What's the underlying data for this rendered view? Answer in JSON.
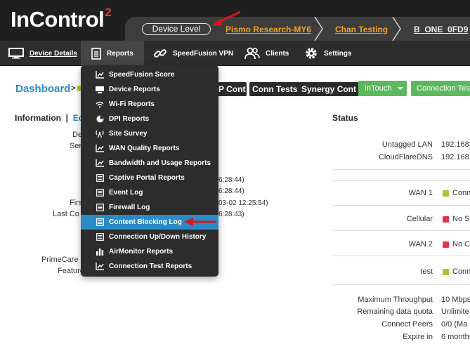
{
  "header": {
    "logo_text": "InControl",
    "logo_sup": "2",
    "device_level": "Device Level",
    "breadcrumbs": [
      "Pismo Research-MY6",
      "Chan Testing",
      "B_ONE_0FD9"
    ]
  },
  "nav": {
    "device_details": "Device Details",
    "reports": "Reports",
    "speedfusion_vpn": "SpeedFusion VPN",
    "clients": "Clients",
    "settings": "Settings"
  },
  "dashboard": {
    "title": "Dashboard",
    "separator": ">",
    "buttons": [
      "P Cont",
      "Conn Tests",
      "Synergy Cont"
    ],
    "intouch": "InTouch",
    "connection_test": "Connection Test"
  },
  "info": {
    "title": "Information",
    "separator": "|",
    "edit": "Ed",
    "labels": [
      "De",
      "Ser",
      "Firs",
      "Last Co",
      "PrimeCare E",
      "Feature"
    ],
    "values": [
      "6:28:44)",
      "6:28:44)",
      "03-02 12:25:54)",
      "6:28:43)"
    ]
  },
  "status": {
    "title": "Status",
    "rows": [
      {
        "label": "Untagged LAN",
        "value": "192.168."
      },
      {
        "label": "CloudFlareDNS",
        "value": "192.168."
      }
    ],
    "wan": [
      {
        "label": "WAN 1",
        "text": "Conn",
        "color": "#a8c531"
      },
      {
        "label": "Cellular",
        "text": "No S",
        "color": "#e0344a"
      },
      {
        "label": "WAN 2",
        "text": "No C",
        "color": "#e0344a"
      },
      {
        "label": "test",
        "text": "Conn",
        "color": "#a8c531"
      }
    ],
    "details": [
      {
        "label": "Maximum Throughput",
        "value": "10 Mbps"
      },
      {
        "label": "Remaining data quota",
        "value": "Unlimite"
      },
      {
        "label": "Connect Peers",
        "value": "0/0   (Ma"
      },
      {
        "label": "Expire in",
        "value": "6 months"
      }
    ]
  },
  "reports_menu": {
    "items": [
      {
        "label": "SpeedFusion Score",
        "icon": "chart-line-icon"
      },
      {
        "label": "Device Reports",
        "icon": "monitor-icon"
      },
      {
        "label": "Wi-Fi Reports",
        "icon": "wifi-icon"
      },
      {
        "label": "DPI Reports",
        "icon": "pie-chart-icon"
      },
      {
        "label": "Site Survey",
        "icon": "antenna-icon"
      },
      {
        "label": "WAN Quality Reports",
        "icon": "chart-line-icon"
      },
      {
        "label": "Bandwidth and Usage Reports",
        "icon": "chart-line-icon"
      },
      {
        "label": "Captive Portal Reports",
        "icon": "list-icon"
      },
      {
        "label": "Event Log",
        "icon": "list-icon"
      },
      {
        "label": "Firewall Log",
        "icon": "list-icon"
      },
      {
        "label": "Content Blocking Log",
        "icon": "list-icon"
      },
      {
        "label": "Connection Up/Down History",
        "icon": "list-icon"
      },
      {
        "label": "AirMonitor Reports",
        "icon": "bar-chart-icon"
      },
      {
        "label": "Connection Test Reports",
        "icon": "chart-line-icon"
      }
    ],
    "selected": "Content Blocking Log"
  },
  "colors": {
    "header_bg": "#1f1f1f",
    "nav_bg": "#2d2d2d",
    "accent_blue": "#2b8bc6",
    "breadcrumb_orange": "#f0a21f",
    "green_button": "#5cb85c",
    "status_green": "#a8c531",
    "status_red": "#e0344a",
    "annotation_red": "#d9161c"
  }
}
